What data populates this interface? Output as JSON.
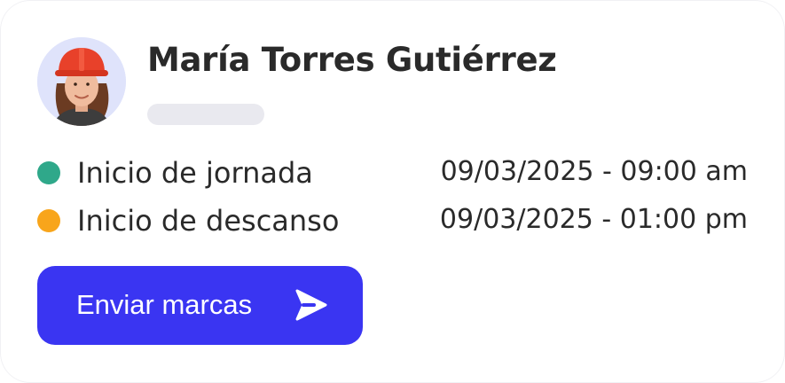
{
  "user": {
    "name": "María Torres Gutiérrez",
    "avatar_icon": "worker-avatar-icon"
  },
  "events": [
    {
      "label": "Inicio de jornada",
      "time": "09/03/2025 - 09:00 am",
      "color": "#2fa88a"
    },
    {
      "label": "Inicio de descanso",
      "time": "09/03/2025 - 01:00 pm",
      "color": "#f8a51b"
    }
  ],
  "actions": {
    "send_label": "Enviar marcas",
    "send_icon": "send-icon",
    "button_color": "#3a35f2"
  }
}
